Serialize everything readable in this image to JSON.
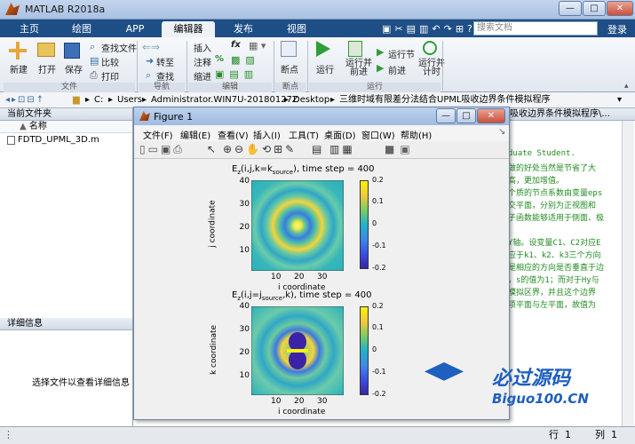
{
  "window": {
    "title": "MATLAB R2018a",
    "minimize": "—",
    "maximize": "□",
    "close": "✕"
  },
  "tabs": [
    {
      "label": "主页"
    },
    {
      "label": "绘图"
    },
    {
      "label": "APP"
    },
    {
      "label": "编辑器",
      "active": true
    },
    {
      "label": "发布"
    },
    {
      "label": "视图"
    }
  ],
  "search": {
    "placeholder": "搜索文档"
  },
  "login": "登录",
  "ribbon": {
    "file": {
      "new": "新建",
      "open": "打开",
      "save": "保存",
      "find_files": "查找文件",
      "compare": "比较",
      "print": "打印",
      "group": "文件"
    },
    "nav": {
      "goto": "转至",
      "find": "查找",
      "group": "导航"
    },
    "edit": {
      "insert": "插入",
      "fx": "fx",
      "comment": "注释",
      "percent": "%",
      "indent": "缩进",
      "group": "编辑"
    },
    "breakpoints": {
      "label": "断点",
      "group": "断点"
    },
    "run": {
      "run": "运行",
      "run_advance": "运行并\n前进",
      "run_section": "运行节",
      "advance": "前进",
      "run_time": "运行并\n计时",
      "group": "运行"
    }
  },
  "address": {
    "path": [
      "C:",
      "Users",
      "Administrator.WIN7U-20180127Z",
      "Desktop",
      "三维时域有限差分法结合UPML吸收边界条件模拟程序"
    ]
  },
  "left_panel": {
    "title": "当前文件夹",
    "column": "名称",
    "sort": "▲",
    "files": [
      {
        "name": "FDTD_UPML_3D.m"
      }
    ],
    "details_title": "详细信息",
    "details_text": "选择文件以查看详细信息"
  },
  "editor": {
    "tab_title": "吸收边界条件模拟程序\\...",
    "lines": [
      "duate Student.",
      "做的好处当然是节省了大",
      "高，更加增值。",
      "个质的节点系数由变量eps",
      "交平面，分别为正视图和",
      "子函数能够适用于侧面、极",
      "",
      "Y轴。设变量C1、C2对应E",
      "应于k1、k2、k3三个方向",
      "是相应的方向是否垂直于边",
      "，s的值为1；而对于Hy与",
      "模拟区界，并且这个边界",
      "项平面与左平面，故值为"
    ]
  },
  "figure": {
    "title": "Figure 1",
    "menu": [
      "文件(F)",
      "编辑(E)",
      "查看(V)",
      "插入(I)",
      "工具(T)",
      "桌面(D)",
      "窗口(W)",
      "帮助(H)"
    ],
    "plot1": {
      "title_main": "E",
      "title_sub_z": "z",
      "title_rest": "(i,j,k=k",
      "title_sub_source": "source",
      "title_end": "), time step = 400",
      "xlabel": "i coordinate",
      "ylabel": "j coordinate",
      "xticks": [
        "10",
        "20",
        "30"
      ],
      "yticks": [
        "40",
        "30",
        "20",
        "10"
      ],
      "cbticks": [
        "0.2",
        "0.1",
        "0",
        "-0.1",
        "-0.2"
      ]
    },
    "plot2": {
      "title_main": "E",
      "title_sub_z": "z",
      "title_rest": "(i,j=j",
      "title_sub_source": "source",
      "title_end": ",k), time step = 400",
      "xlabel": "i coordinate",
      "ylabel": "k coordinate",
      "xticks": [
        "10",
        "20",
        "30"
      ],
      "yticks": [
        "40",
        "30",
        "20",
        "10"
      ],
      "cbticks": [
        "0.2",
        "0.1",
        "0",
        "-0.1",
        "-0.2"
      ]
    }
  },
  "status": {
    "line_label": "行",
    "line_value": "1",
    "col_label": "列",
    "col_value": "1"
  },
  "watermark": {
    "text1": "必过源码",
    "text2": "Biguo100.CN"
  }
}
